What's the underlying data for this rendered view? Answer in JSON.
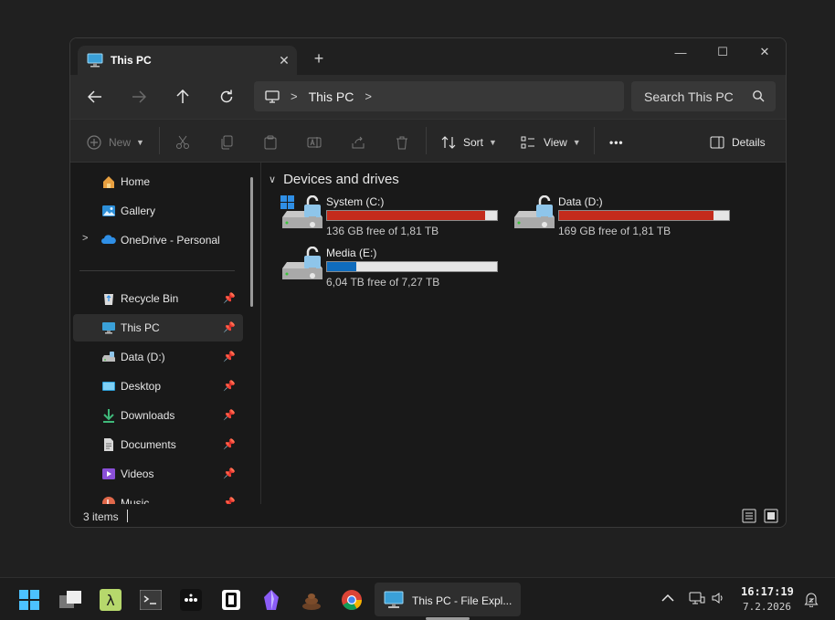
{
  "window": {
    "tab_title": "This PC",
    "tab_close": "✕",
    "new_tab": "+",
    "minimize": "—",
    "maximize": "☐",
    "close": "✕"
  },
  "nav": {
    "breadcrumb_current": "This PC",
    "search_placeholder": "Search This PC"
  },
  "toolbar": {
    "new_label": "New",
    "sort_label": "Sort",
    "view_label": "View",
    "more_label": "•••",
    "details_label": "Details"
  },
  "sidebar": {
    "items": [
      {
        "label": "Home",
        "icon": "home-icon"
      },
      {
        "label": "Gallery",
        "icon": "gallery-icon"
      },
      {
        "label": "OneDrive - Personal",
        "icon": "onedrive-icon"
      },
      {
        "label": "Recycle Bin",
        "icon": "recycle-bin-icon"
      },
      {
        "label": "This PC",
        "icon": "pc-icon"
      },
      {
        "label": "Data (D:)",
        "icon": "drive-icon"
      },
      {
        "label": "Desktop",
        "icon": "desktop-icon"
      },
      {
        "label": "Downloads",
        "icon": "downloads-icon"
      },
      {
        "label": "Documents",
        "icon": "documents-icon"
      },
      {
        "label": "Videos",
        "icon": "videos-icon"
      },
      {
        "label": "Music",
        "icon": "music-icon"
      }
    ]
  },
  "content": {
    "group_title": "Devices and drives",
    "drives": [
      {
        "name": "System (C:)",
        "free": "136 GB free of 1,81 TB",
        "used_fraction": 0.93,
        "bar_color": "#c42b1c"
      },
      {
        "name": "Data (D:)",
        "free": "169 GB free of 1,81 TB",
        "used_fraction": 0.91,
        "bar_color": "#c42b1c"
      },
      {
        "name": "Media (E:)",
        "free": "6,04 TB free of 7,27 TB",
        "used_fraction": 0.17,
        "bar_color": "#0f6cbd"
      }
    ]
  },
  "status": {
    "items_count": "3 items"
  },
  "taskbar": {
    "active_app_label": "This PC - File Expl...",
    "time": "16:17:19",
    "date": "7.2.2026"
  }
}
